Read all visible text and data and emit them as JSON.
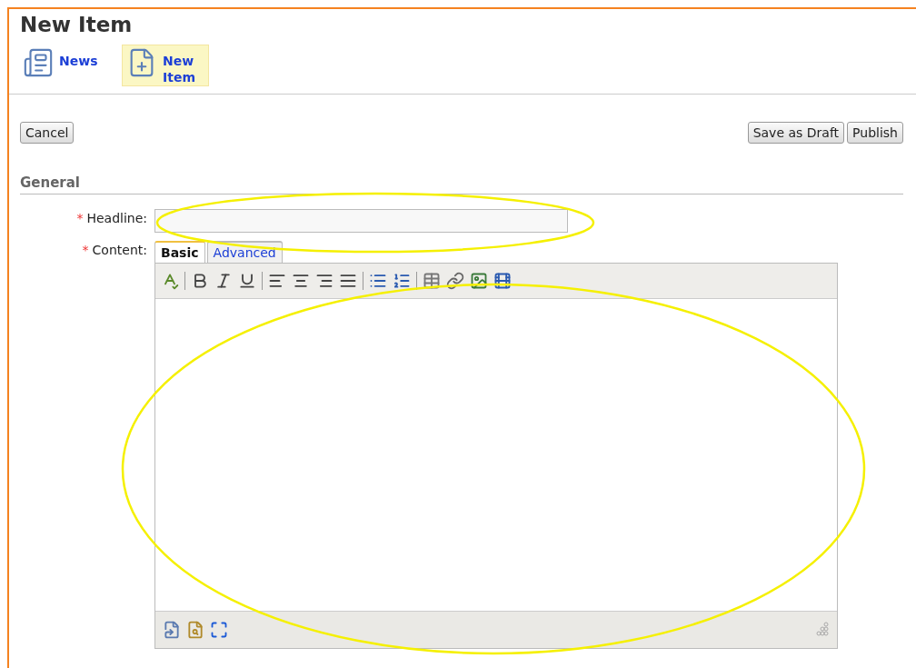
{
  "page": {
    "title": "New Item"
  },
  "nav": [
    {
      "label": "News",
      "selected": false
    },
    {
      "label": "New Item",
      "selected": true
    }
  ],
  "actions": {
    "left": [
      "Cancel"
    ],
    "right": [
      "Save as Draft",
      "Publish"
    ]
  },
  "section": {
    "title": "General"
  },
  "fields": [
    {
      "label": "Headline:",
      "required_mark": "*",
      "kind": "text"
    },
    {
      "label": "Content:",
      "required_mark": "*",
      "kind": "editor",
      "tabs": [
        {
          "label": "Basic",
          "selected": true
        },
        {
          "label": "Advanced",
          "selected": false
        }
      ]
    }
  ]
}
